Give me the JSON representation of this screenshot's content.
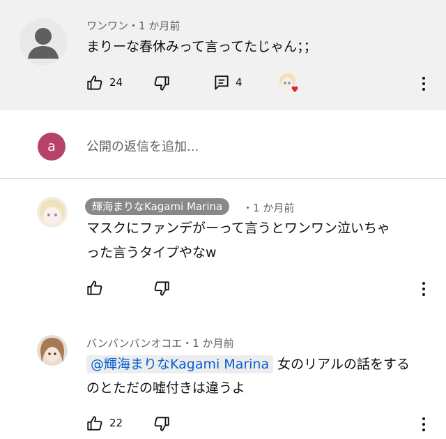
{
  "comment1": {
    "author": "ワンワン",
    "time": "1 か月前",
    "text": "まりーな春休みって言ってたじゃん；；",
    "likes": "24",
    "replies": "4"
  },
  "reply_box": {
    "avatar_letter": "a",
    "placeholder": "公開の返信を追加..."
  },
  "reply1": {
    "author": "輝海まりなKagami Marina",
    "time": "1 か月前",
    "text_line1": "マスクにファンデがーって言うとワンワン泣いちゃ",
    "text_line2": "った言うタイプやなw"
  },
  "reply2": {
    "author": "バンバンバンオコエ",
    "time": "1 か月前",
    "mention": "@輝海まりなKagami Marina",
    "text_line1": "女のリアルの話をする",
    "text_line2": "のとただの嘘付きは違うよ",
    "likes": "22"
  },
  "separator": "・",
  "icons": [
    "default-avatar-icon",
    "like-icon",
    "dislike-icon",
    "reply-icon",
    "creator-heart-icon",
    "more-icon"
  ],
  "colors": {
    "top_bg": "#f1f1f1",
    "letter_avatar": "#b8436a",
    "chip_bg": "#888888",
    "mention": "#065fd4",
    "heart": "#e0242a"
  }
}
